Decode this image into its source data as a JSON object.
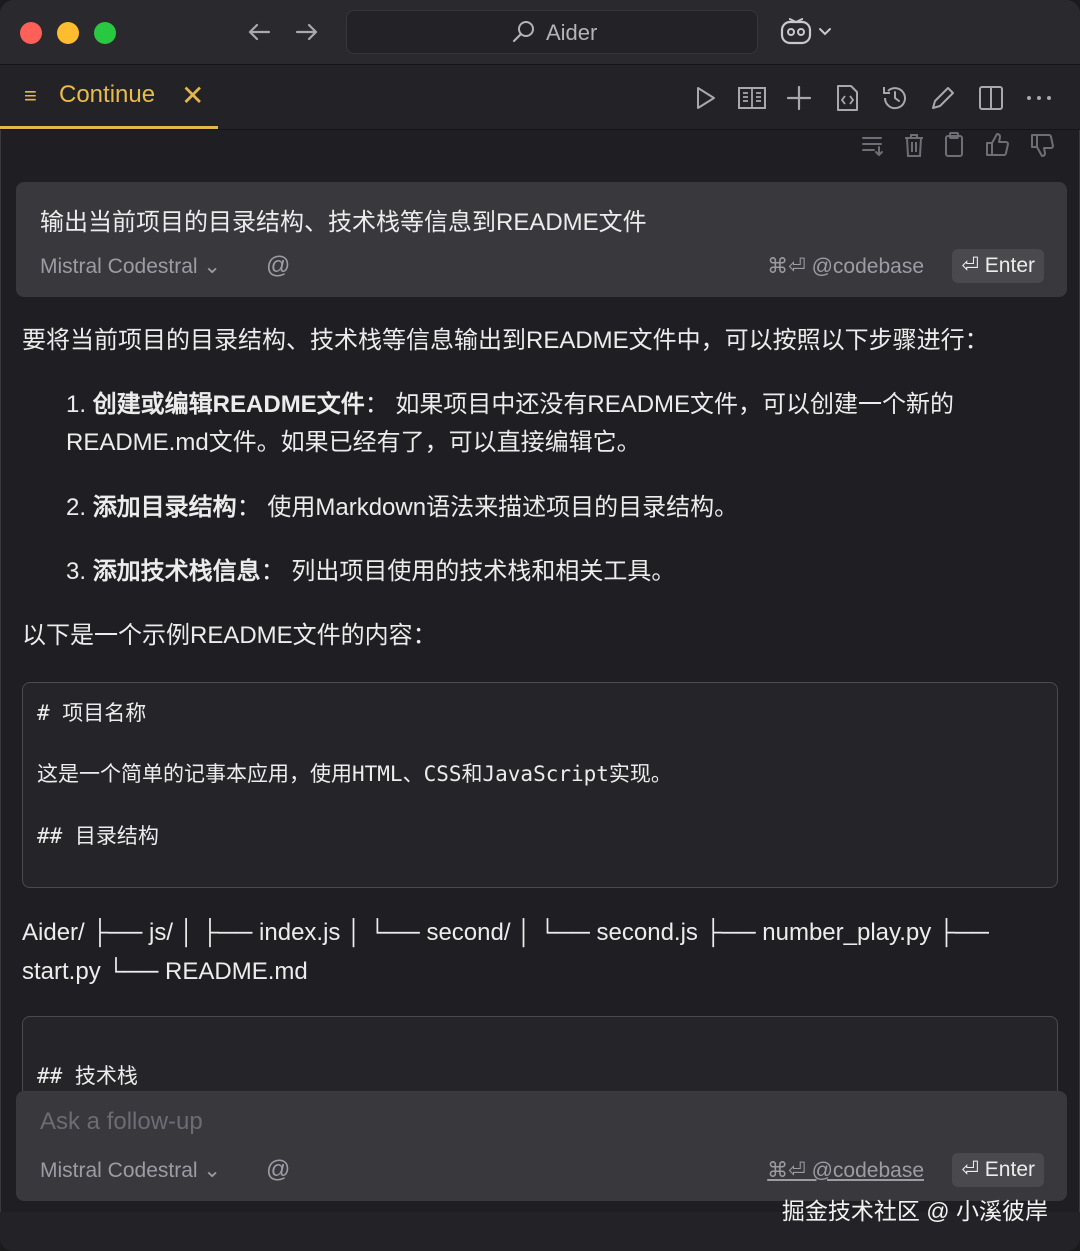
{
  "titlebar": {
    "search_label": "Aider",
    "nav_back_icon": "arrow-left-icon",
    "nav_forward_icon": "arrow-right-icon",
    "copilot_icon": "copilot-icon"
  },
  "tab": {
    "label": "Continue",
    "accent": "#e1b84a"
  },
  "user_message": {
    "text": "输出当前项目的目录结构、技术栈等信息到README文件",
    "model": "Mistral Codestral",
    "codebase_shortcut": "⌘⏎ @codebase",
    "enter_label": "⏎ Enter"
  },
  "response": {
    "intro": "要将当前项目的目录结构、技术栈等信息输出到README文件中，可以按照以下步骤进行：",
    "steps": [
      {
        "num": "1.",
        "title": "创建或编辑README文件",
        "sep": "：",
        "text": "如果项目中还没有README文件，可以创建一个新的README.md文件。如果已经有了，可以直接编辑它。"
      },
      {
        "num": "2.",
        "title": "添加目录结构",
        "sep": "：",
        "text": "使用Markdown语法来描述项目的目录结构。"
      },
      {
        "num": "3.",
        "title": "添加技术栈信息",
        "sep": "：",
        "text": "列出项目使用的技术栈和相关工具。"
      }
    ],
    "example_intro": "以下是一个示例README文件的内容：",
    "code1": [
      "# 项目名称",
      "这是一个简单的记事本应用，使用HTML、CSS和JavaScript实现。",
      "## 目录结构"
    ],
    "tree_text": "Aider/ ├── js/ │ ├── index.js │ └── second/ │ └── second.js ├── number_play.py ├── start.py └── README.md",
    "code2": [
      "## 技术栈"
    ]
  },
  "followup": {
    "placeholder": "Ask a follow-up",
    "model": "Mistral Codestral",
    "codebase_shortcut": "⌘⏎ @codebase",
    "enter_label": "⏎ Enter"
  },
  "watermark": "掘金技术社区 @ 小溪彼岸"
}
